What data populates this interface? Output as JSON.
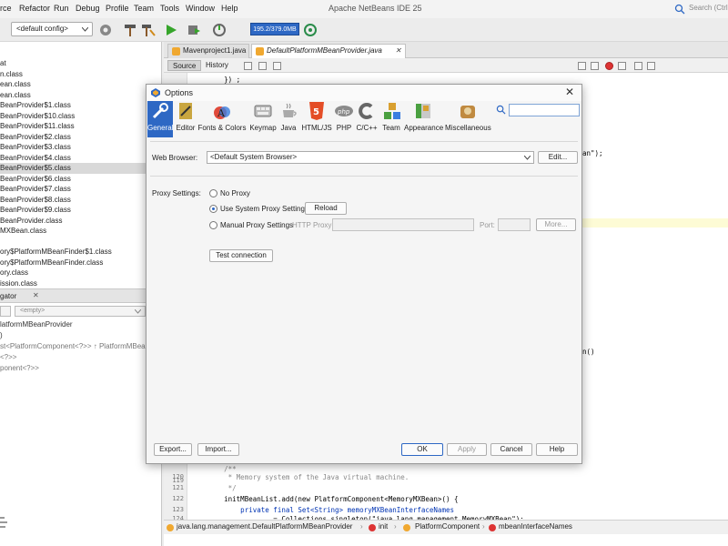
{
  "window": {
    "title": "Apache NetBeans IDE 25",
    "menu": [
      "rce",
      "Refactor",
      "Run",
      "Debug",
      "Profile",
      "Team",
      "Tools",
      "Window",
      "Help"
    ],
    "search_placeholder": "Search (Ctrl+"
  },
  "toolbar": {
    "config_value": "<default config>",
    "memory_label": "195.2/379.0MB"
  },
  "left_tree": {
    "items": [
      "at",
      "n.class",
      "ean.class",
      "ean.class",
      "BeanProvider$1.class",
      "BeanProvider$10.class",
      "BeanProvider$11.class",
      "BeanProvider$2.class",
      "BeanProvider$3.class",
      "BeanProvider$4.class",
      "BeanProvider$5.class",
      "BeanProvider$6.class",
      "BeanProvider$7.class",
      "BeanProvider$8.class",
      "BeanProvider$9.class",
      "BeanProvider.class",
      "MXBean.class",
      "",
      "ory$PlatformMBeanFinder$1.class",
      "ory$PlatformMBeanFinder.class",
      "ory.class",
      "ission.class"
    ],
    "selected_index": 10
  },
  "navigator": {
    "title": "gator",
    "filter_left": "",
    "filter_right": "<empty>",
    "items": [
      "latformMBeanProvider",
      ")",
      "st<PlatformComponent<?>> ↑ PlatformMBeanF",
      "<?>>",
      "ponent<?>>"
    ]
  },
  "editor": {
    "tabs": [
      "Mavenproject1.java",
      "DefaultPlatformMBeanProvider.java"
    ],
    "active_tab": 1,
    "view_buttons": [
      "Source",
      "History"
    ],
    "code_top": "        }) ;",
    "right_fragments": [
      "an\");",
      "n()"
    ],
    "lines": [
      {
        "num": "119",
        "text": "        /**"
      },
      {
        "num": "120",
        "text": "         * Memory system of the Java virtual machine."
      },
      {
        "num": "121",
        "text": "         */"
      },
      {
        "num": "122",
        "text": "        initMBeanList.add(new PlatformComponent<MemoryMXBean>() {"
      },
      {
        "num": "123",
        "text": "            private final Set<String> memoryMXBeanInterfaceNames"
      },
      {
        "num": "124",
        "text": "                    = Collections.singleton(\"java.lang.management.MemoryMXBean\");"
      }
    ],
    "breadcrumbs": [
      "java.lang.management.DefaultPlatformMBeanProvider",
      "init",
      "PlatformComponent",
      "mbeanInterfaceNames"
    ]
  },
  "dialog": {
    "title": "Options",
    "categories": [
      {
        "label": "General",
        "icon": "general-icon"
      },
      {
        "label": "Editor",
        "icon": "editor-icon"
      },
      {
        "label": "Fonts & Colors",
        "icon": "fonts-colors-icon"
      },
      {
        "label": "Keymap",
        "icon": "keymap-icon"
      },
      {
        "label": "Java",
        "icon": "java-icon"
      },
      {
        "label": "HTML/JS",
        "icon": "html-js-icon"
      },
      {
        "label": "PHP",
        "icon": "php-icon"
      },
      {
        "label": "C/C++",
        "icon": "cpp-icon"
      },
      {
        "label": "Team",
        "icon": "team-icon"
      },
      {
        "label": "Appearance",
        "icon": "appearance-icon"
      },
      {
        "label": "Miscellaneous",
        "icon": "miscellaneous-icon"
      }
    ],
    "selected_category": 0,
    "web_browser_label": "Web Browser:",
    "web_browser_value": "<Default System Browser>",
    "edit_button": "Edit...",
    "proxy_label": "Proxy Settings:",
    "proxy_options": [
      "No Proxy",
      "Use System Proxy Settings",
      "Manual Proxy Settings"
    ],
    "proxy_selected": 1,
    "reload_button": "Reload",
    "http_proxy_label": "HTTP Proxy:",
    "port_label": "Port:",
    "more_button": "More...",
    "test_connection_button": "Test connection",
    "export_button": "Export...",
    "import_button": "Import...",
    "ok_button": "OK",
    "apply_button": "Apply",
    "cancel_button": "Cancel",
    "help_button": "Help"
  },
  "colors": {
    "accent": "#2e68c4",
    "selection_gray": "#d9d9d9"
  }
}
